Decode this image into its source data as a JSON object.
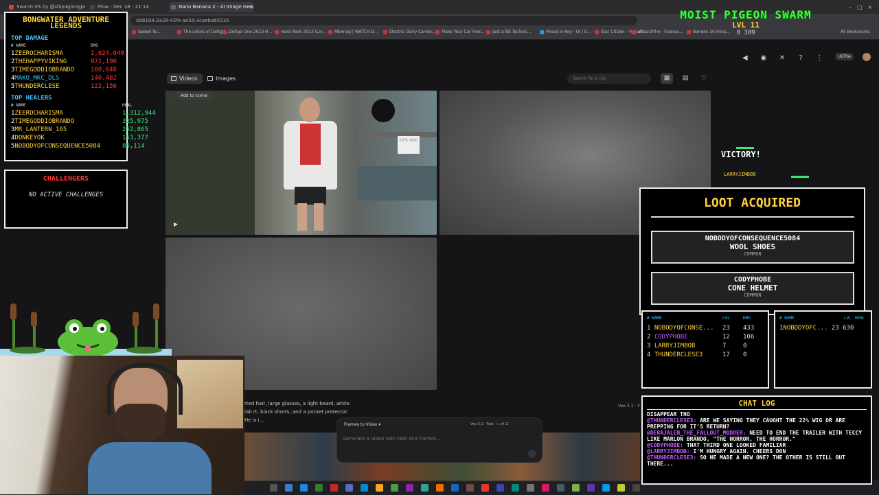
{
  "browser": {
    "tabs": [
      {
        "label": "Swarm VS by @shiyaglongper"
      },
      {
        "label": "Flow - Dec 18 - 21:14"
      },
      {
        "label": "Nano Banana 2 - AI Image Gen"
      }
    ],
    "url": "0d8194-2a28-42fe-ae5d-3caeba65535",
    "bookmarks": [
      "Speed Te...",
      "The colors of Deltgo...",
      "Deltgo One 2013 H...",
      "Hard Rock 2013 (Liv...",
      "Mbenag | WATCH D...",
      "Electric Dairy Carrier...",
      "Make Your Car Feel...",
      "Just a Bit Technic...",
      "Mixed in Key - UI / S...",
      "Star Citizen - Vogue...",
      "VReachfire - Falesus...",
      "Boneko 30 mins..."
    ],
    "all_bookmarks": "All Bookmarks"
  },
  "flow": {
    "tabs": {
      "videos": "Videos",
      "images": "Images"
    },
    "search_placeholder": "Search for a clip",
    "add_to_scene": "Add to scene",
    "wig_sign": "22% WIG",
    "prompt_text": "rted hair, large glasses, a light beard, white lab rt, black shorts, and a pocket protector. He is i...",
    "composer": {
      "mode": "Frames to Video",
      "model": "Veo 3.1 - Fast",
      "count": "x4",
      "placeholder": "Generate a video with text and frames..."
    },
    "veo_label": "Veo 3.1 - F",
    "ultra": "ULTRA"
  },
  "leaderboard": {
    "title_line1": "BONGWATER ADVENTURE",
    "title_line2": "LEGENDS",
    "damage": {
      "heading": "TOP DAMAGE",
      "col_name": "# NAME",
      "col_val": "DMG",
      "rows": [
        {
          "rank": "1",
          "name": "ZEEROCHARISMA",
          "value": "1,624,040"
        },
        {
          "rank": "2",
          "name": "THEHAPPYVIKING",
          "value": "871,190"
        },
        {
          "rank": "3",
          "name": "TIMEGODDIOBRANDO",
          "value": "180,048"
        },
        {
          "rank": "4",
          "name": "MAKO_MKC_DLS",
          "value": "140,482"
        },
        {
          "rank": "5",
          "name": "THUNDERCLESE",
          "value": "122,156"
        }
      ]
    },
    "healers": {
      "heading": "TOP HEALERS",
      "col_name": "# NAME",
      "col_val": "HEAL",
      "rows": [
        {
          "rank": "1",
          "name": "ZEEROCHARISMA",
          "value": "1,312,944"
        },
        {
          "rank": "2",
          "name": "TIMEGODDIOBRANDO",
          "value": "325,975"
        },
        {
          "rank": "3",
          "name": "MR_LANTERN_165",
          "value": "252,865"
        },
        {
          "rank": "4",
          "name": "DONKEYOK",
          "value": "153,377"
        },
        {
          "rank": "5",
          "name": "NOBODYOFCONSEQUENCE5084",
          "value": "86,114"
        }
      ]
    }
  },
  "challengers": {
    "title": "CHALLENGERS",
    "status": "NO ACTIVE CHALLENGES"
  },
  "swarm": {
    "title": "MOIST PIGEON SWARM",
    "level": "LVL 11",
    "stats": "0 309"
  },
  "battle": {
    "victory": "VICTORY!",
    "victor": "LARRYJIMBOB"
  },
  "loot": {
    "title": "LOOT ACQUIRED",
    "items": [
      {
        "player": "NOBODYOFCONSEQUENCE5084",
        "item": "WOOL SHOES",
        "rarity": "COMMON"
      },
      {
        "player": "CODYPHOBE",
        "item": "CONE HELMET",
        "rarity": "COMMON"
      }
    ]
  },
  "party": {
    "headers": {
      "name": "# NAME",
      "lvl": "LVL",
      "dmg": "DMG"
    },
    "rows": [
      {
        "rank": "1",
        "name": "NOBODYOFCONSE...",
        "lvl": "23",
        "dmg": "433"
      },
      {
        "rank": "2",
        "name": "CODYPHOBE",
        "lvl": "12",
        "dmg": "106"
      },
      {
        "rank": "3",
        "name": "LARRYJIMBOB",
        "lvl": "7",
        "dmg": "0"
      },
      {
        "rank": "4",
        "name": "THUNDERCLESE3",
        "lvl": "17",
        "dmg": "0"
      }
    ]
  },
  "party2": {
    "headers": {
      "name": "# NAME",
      "lvl": "LVL",
      "heal": "HEAL"
    },
    "rows": [
      {
        "rank": "1",
        "name": "NOBODYOFC...",
        "lvl": "23",
        "heal": "630"
      }
    ]
  },
  "chat": {
    "title": "CHAT LOG",
    "lines": [
      {
        "user": "",
        "text": "DISAPPEAR THO"
      },
      {
        "user": "@THUNDERCLESE3:",
        "text": "ARE WE SAYING THEY CAUGHT THE 22% WIG OR ARE PREPPING FOR IT'S RETURN?"
      },
      {
        "user": "@DERAJALEN_THE_FALLOUT_MODDER:",
        "text": "NEED TO END THE TRAILER WITH TECCY LIKE MARLON BRANDO, \"THE HORROR, THE HORROR.\""
      },
      {
        "user": "@CODYPHOBE:",
        "text": "THAT THIRD ONE LOOKED FAMILIAR"
      },
      {
        "user": "@LARRYJIMBOB:",
        "text": "I'M HUNGRY AGAIN. CHEERS DON"
      },
      {
        "user": "@THUNDERCLESE3:",
        "text": "SO HE MADE A NEW ONE? THE OTHER IS STILL OUT THERE..."
      }
    ]
  },
  "colors": {
    "gold": "#ffd23a",
    "cyan": "#3cc3ff",
    "red": "#ff3b3b",
    "green": "#3be67a",
    "purple": "#c85cff"
  }
}
